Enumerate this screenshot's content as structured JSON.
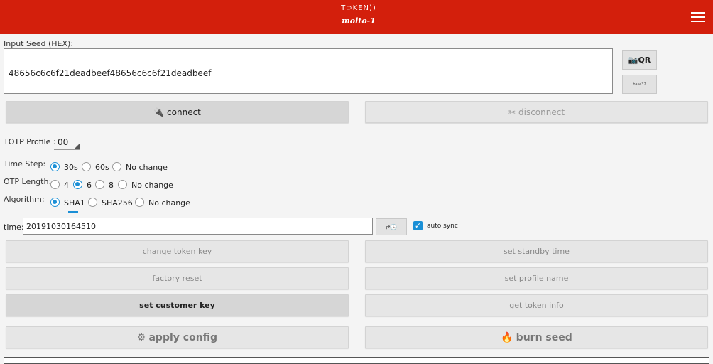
{
  "header": {
    "logo_top": "T⊃KEN))",
    "logo_bottom": "molto-1",
    "bg_color": "#d31f0c"
  },
  "seed": {
    "label": "Input Seed (HEX):",
    "value": "48656c6c6f21deadbeef48656c6c6f21deadbeef",
    "qr_label": "QR",
    "base32_label": "base32"
  },
  "connection": {
    "connect_label": "connect",
    "disconnect_label": "disconnect"
  },
  "totp": {
    "profile_label": "TOTP Profile :",
    "profile_value": "00"
  },
  "time_step": {
    "label": "Time Step:",
    "options": [
      "30s",
      "60s",
      "No change"
    ],
    "selected": "30s"
  },
  "otp_length": {
    "label": "OTP Length:",
    "options": [
      "4",
      "6",
      "8",
      "No change"
    ],
    "selected": "6"
  },
  "algorithm": {
    "label": "Algorithm:",
    "options": [
      "SHA1",
      "SHA256",
      "No change"
    ],
    "selected": "SHA1"
  },
  "time": {
    "label": "time:",
    "value": "20191030164510",
    "sync_button": "⇄🕒",
    "auto_sync_label": "auto sync",
    "auto_sync_checked": true
  },
  "actions": {
    "change_token_key": "change token key",
    "set_standby_time": "set standby time",
    "factory_reset": "factory reset",
    "set_profile_name": "set profile name",
    "set_customer_key": "set customer key",
    "get_token_info": "get token info",
    "apply_config": "apply config",
    "burn_seed": "burn seed"
  },
  "accent_color": "#1a8fd6"
}
